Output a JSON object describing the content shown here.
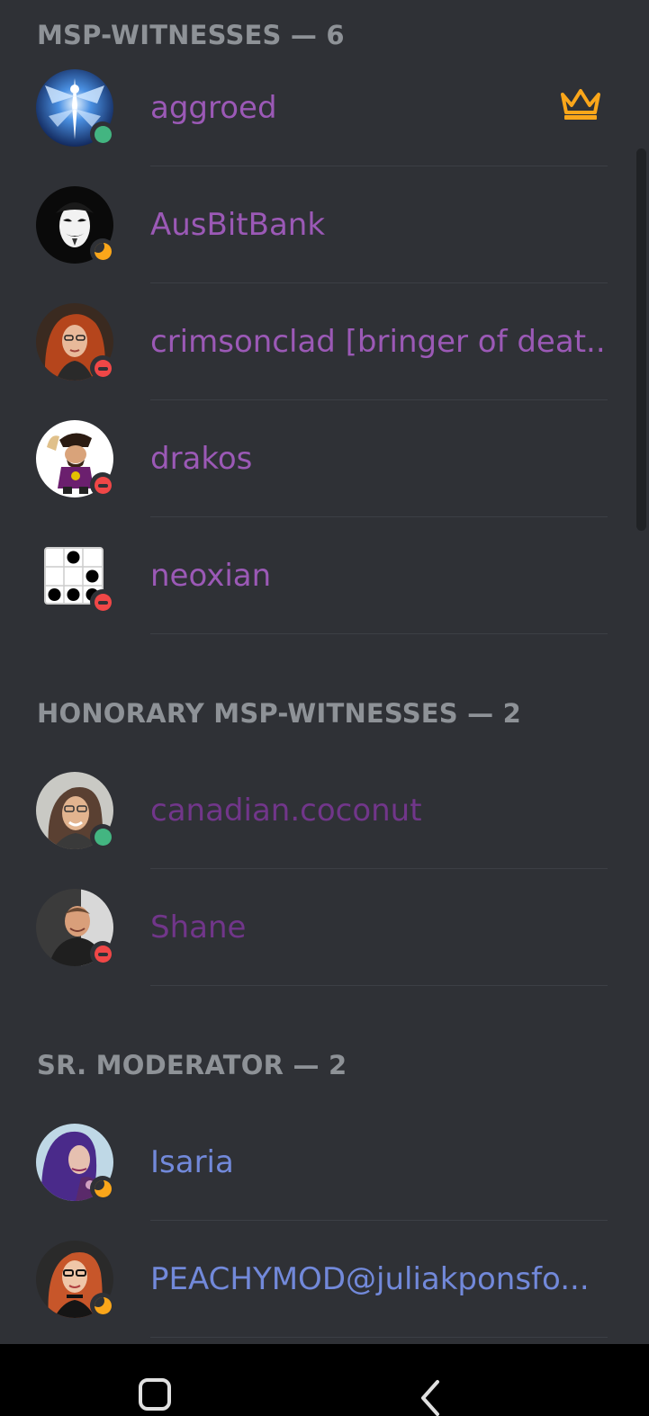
{
  "colors": {
    "background": "#2f3136",
    "header_text": "#8e9297",
    "witness_name": "#9b59b6",
    "honorary_name": "#71368a",
    "moderator_name": "#7289da",
    "online": "#43b581",
    "idle": "#faa61a",
    "dnd": "#f04747",
    "crown": "#faa61a"
  },
  "sections": [
    {
      "header": "MSP-WITNESSES — 6",
      "members": [
        {
          "name": "aggroed",
          "status": "online",
          "badge": "crown-icon"
        },
        {
          "name": "AusBitBank",
          "status": "idle"
        },
        {
          "name": "crimsonclad [bringer of deat...",
          "status": "dnd"
        },
        {
          "name": "drakos",
          "status": "dnd"
        },
        {
          "name": "neoxian",
          "status": "dnd"
        }
      ]
    },
    {
      "header": "HONORARY MSP-WITNESSES — 2",
      "members": [
        {
          "name": "canadian.coconut",
          "status": "online"
        },
        {
          "name": "Shane",
          "status": "dnd"
        }
      ]
    },
    {
      "header": "SR. MODERATOR — 2",
      "members": [
        {
          "name": "Isaria",
          "status": "idle"
        },
        {
          "name": "PEACHYMOD@juliakponsfo...",
          "status": "idle"
        }
      ]
    }
  ],
  "nav": {
    "home_icon": "home-square-icon",
    "back_icon": "back-chevron-icon"
  }
}
